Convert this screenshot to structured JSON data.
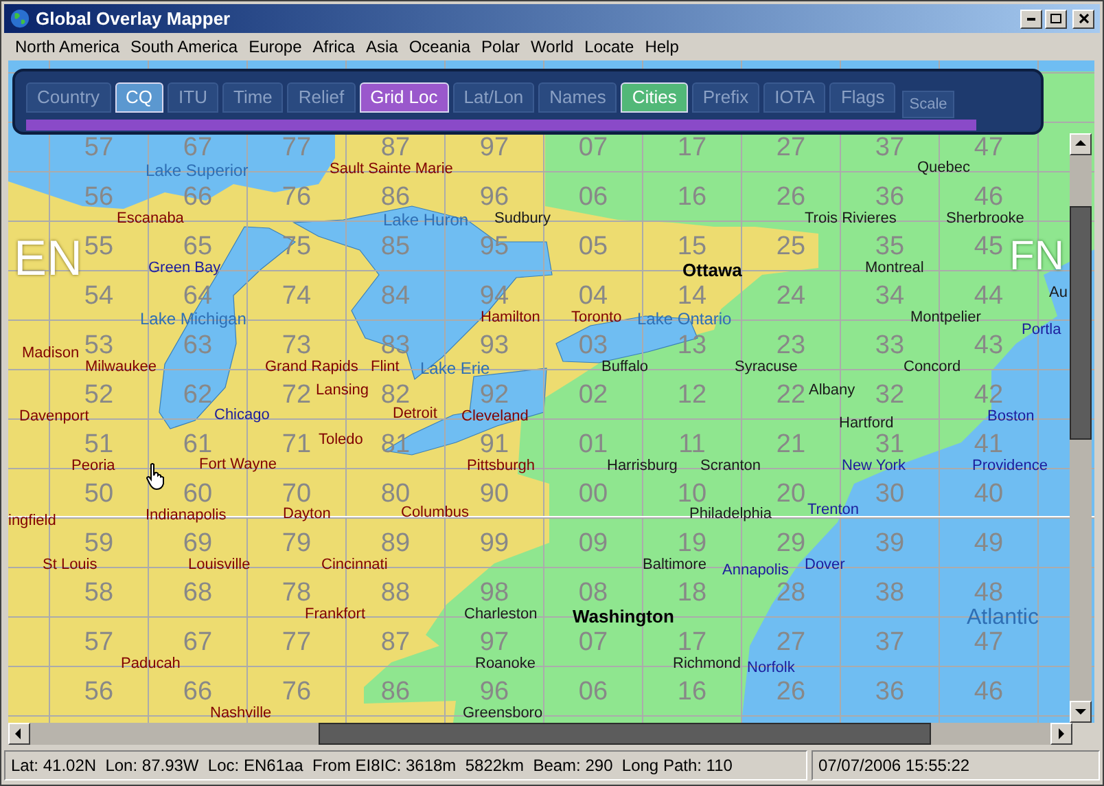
{
  "window": {
    "title": "Global Overlay Mapper"
  },
  "menu": [
    "North America",
    "South America",
    "Europe",
    "Africa",
    "Asia",
    "Oceania",
    "Polar",
    "World",
    "Locate",
    "Help"
  ],
  "overlay_tabs": [
    {
      "label": "Country",
      "on": false
    },
    {
      "label": "CQ",
      "on": true,
      "color": "#5b98d0"
    },
    {
      "label": "ITU",
      "on": false
    },
    {
      "label": "Time",
      "on": false
    },
    {
      "label": "Relief",
      "on": false
    },
    {
      "label": "Grid Loc",
      "on": true,
      "color": "#9a58cc"
    },
    {
      "label": "Lat/Lon",
      "on": false
    },
    {
      "label": "Names",
      "on": false
    },
    {
      "label": "Cities",
      "on": true,
      "color": "#52b878"
    },
    {
      "label": "Prefix",
      "on": false
    },
    {
      "label": "IOTA",
      "on": false
    },
    {
      "label": "Flags",
      "on": false
    }
  ],
  "scale_button": "Scale",
  "map": {
    "field_labels": [
      "EN",
      "FN"
    ],
    "grid": [
      [
        "57",
        "67",
        "77",
        "87",
        "97",
        "07",
        "17",
        "27",
        "37",
        "47"
      ],
      [
        "56",
        "66",
        "76",
        "86",
        "96",
        "06",
        "16",
        "26",
        "36",
        "46"
      ],
      [
        "55",
        "65",
        "75",
        "85",
        "95",
        "05",
        "15",
        "25",
        "35",
        "45"
      ],
      [
        "54",
        "64",
        "74",
        "84",
        "94",
        "04",
        "14",
        "24",
        "34",
        "44"
      ],
      [
        "53",
        "63",
        "73",
        "83",
        "93",
        "03",
        "13",
        "23",
        "33",
        "43"
      ],
      [
        "52",
        "62",
        "72",
        "82",
        "92",
        "02",
        "12",
        "22",
        "32",
        "42"
      ],
      [
        "51",
        "61",
        "71",
        "81",
        "91",
        "01",
        "11",
        "21",
        "31",
        "41"
      ],
      [
        "50",
        "60",
        "70",
        "80",
        "90",
        "00",
        "10",
        "20",
        "30",
        "40"
      ],
      [
        "59",
        "69",
        "79",
        "89",
        "99",
        "09",
        "19",
        "29",
        "39",
        "49"
      ],
      [
        "58",
        "68",
        "78",
        "88",
        "98",
        "08",
        "18",
        "28",
        "38",
        "48"
      ],
      [
        "57",
        "67",
        "77",
        "87",
        "97",
        "07",
        "17",
        "27",
        "37",
        "47"
      ],
      [
        "56",
        "66",
        "76",
        "86",
        "96",
        "06",
        "16",
        "26",
        "36",
        "46"
      ]
    ],
    "water_labels": [
      "Lake Superior",
      "Lake Huron",
      "Lake Michigan",
      "Lake Ontario",
      "Lake Erie",
      "Atlantic"
    ],
    "cities": [
      {
        "name": "Sault Sainte Marie",
        "kind": "city",
        "color": "#800000"
      },
      {
        "name": "Quebec",
        "kind": "city",
        "color": "#1a1a1a"
      },
      {
        "name": "Escanaba",
        "kind": "city",
        "color": "#800000"
      },
      {
        "name": "Sudbury",
        "kind": "city",
        "color": "#1a1a1a"
      },
      {
        "name": "Trois Rivieres",
        "kind": "city",
        "color": "#1a1a1a"
      },
      {
        "name": "Sherbrooke",
        "kind": "city",
        "color": "#1a1a1a"
      },
      {
        "name": "Green Bay",
        "kind": "city",
        "color": "#1c1c9c"
      },
      {
        "name": "Ottawa",
        "kind": "capital",
        "color": "#000000"
      },
      {
        "name": "Montreal",
        "kind": "city",
        "color": "#1a1a1a"
      },
      {
        "name": "Au",
        "kind": "city",
        "color": "#1a1a1a"
      },
      {
        "name": "Hamilton",
        "kind": "city",
        "color": "#800000"
      },
      {
        "name": "Toronto",
        "kind": "city",
        "color": "#800000"
      },
      {
        "name": "Montpelier",
        "kind": "city",
        "color": "#1a1a1a"
      },
      {
        "name": "Portla",
        "kind": "city",
        "color": "#1c1c9c"
      },
      {
        "name": "Madison",
        "kind": "city",
        "color": "#800000"
      },
      {
        "name": "Milwaukee",
        "kind": "city",
        "color": "#800000"
      },
      {
        "name": "Grand Rapids",
        "kind": "city",
        "color": "#800000"
      },
      {
        "name": "Flint",
        "kind": "city",
        "color": "#800000"
      },
      {
        "name": "Buffalo",
        "kind": "city",
        "color": "#1a1a1a"
      },
      {
        "name": "Syracuse",
        "kind": "city",
        "color": "#1a1a1a"
      },
      {
        "name": "Concord",
        "kind": "city",
        "color": "#1a1a1a"
      },
      {
        "name": "Lansing",
        "kind": "city",
        "color": "#800000"
      },
      {
        "name": "Albany",
        "kind": "city",
        "color": "#1a1a1a"
      },
      {
        "name": "Davenport",
        "kind": "city",
        "color": "#800000"
      },
      {
        "name": "Chicago",
        "kind": "city",
        "color": "#1c1c9c"
      },
      {
        "name": "Detroit",
        "kind": "city",
        "color": "#800000"
      },
      {
        "name": "Cleveland",
        "kind": "city",
        "color": "#800000"
      },
      {
        "name": "Hartford",
        "kind": "city",
        "color": "#1a1a1a"
      },
      {
        "name": "Boston",
        "kind": "city",
        "color": "#1c1c9c"
      },
      {
        "name": "Toledo",
        "kind": "city",
        "color": "#800000"
      },
      {
        "name": "Peoria",
        "kind": "city",
        "color": "#800000"
      },
      {
        "name": "Fort Wayne",
        "kind": "city",
        "color": "#800000"
      },
      {
        "name": "Pittsburgh",
        "kind": "city",
        "color": "#800000"
      },
      {
        "name": "Harrisburg",
        "kind": "city",
        "color": "#1a1a1a"
      },
      {
        "name": "Scranton",
        "kind": "city",
        "color": "#1a1a1a"
      },
      {
        "name": "New York",
        "kind": "city",
        "color": "#1c1c9c"
      },
      {
        "name": "Providence",
        "kind": "city",
        "color": "#1c1c9c"
      },
      {
        "name": "ingfield",
        "kind": "city",
        "color": "#800000"
      },
      {
        "name": "Indianapolis",
        "kind": "city",
        "color": "#800000"
      },
      {
        "name": "Dayton",
        "kind": "city",
        "color": "#800000"
      },
      {
        "name": "Columbus",
        "kind": "city",
        "color": "#800000"
      },
      {
        "name": "Philadelphia",
        "kind": "city",
        "color": "#1a1a1a"
      },
      {
        "name": "Trenton",
        "kind": "city",
        "color": "#1c1c9c"
      },
      {
        "name": "St Louis",
        "kind": "city",
        "color": "#800000"
      },
      {
        "name": "Louisville",
        "kind": "city",
        "color": "#800000"
      },
      {
        "name": "Cincinnati",
        "kind": "city",
        "color": "#800000"
      },
      {
        "name": "Baltimore",
        "kind": "city",
        "color": "#1a1a1a"
      },
      {
        "name": "Annapolis",
        "kind": "city",
        "color": "#1c1c9c"
      },
      {
        "name": "Dover",
        "kind": "city",
        "color": "#1c1c9c"
      },
      {
        "name": "Frankfort",
        "kind": "city",
        "color": "#800000"
      },
      {
        "name": "Charleston",
        "kind": "city",
        "color": "#1a1a1a"
      },
      {
        "name": "Washington",
        "kind": "capital",
        "color": "#000000"
      },
      {
        "name": "Paducah",
        "kind": "city",
        "color": "#800000"
      },
      {
        "name": "Roanoke",
        "kind": "city",
        "color": "#1a1a1a"
      },
      {
        "name": "Richmond",
        "kind": "city",
        "color": "#1a1a1a"
      },
      {
        "name": "Norfolk",
        "kind": "city",
        "color": "#1c1c9c"
      },
      {
        "name": "Nashville",
        "kind": "city",
        "color": "#800000"
      },
      {
        "name": "Greensboro",
        "kind": "city",
        "color": "#1a1a1a"
      }
    ]
  },
  "status_bar": {
    "position": "Lat: 41.02N  Lon: 87.93W  Loc: EN61aa  From EI8IC: 3618m  5822km  Beam: 290  Long Path: 110",
    "datetime": "07/07/2006 15:55:22"
  }
}
